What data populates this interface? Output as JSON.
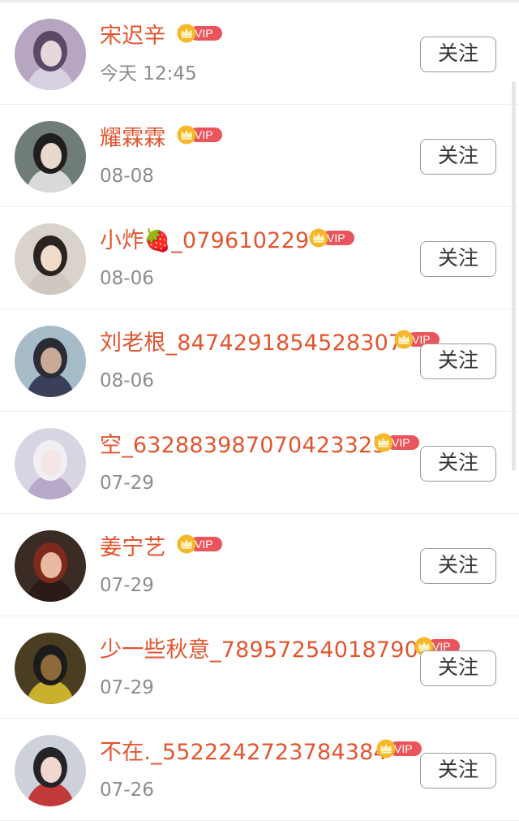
{
  "follow_label": "关注",
  "vip_label": "VIP",
  "colors": {
    "name": "#e2552f",
    "time": "#8c8c8c",
    "vip_badge": "#e9555a",
    "crown": "#f5b82a"
  },
  "rows": [
    {
      "name": "宋迟辛",
      "time": "今天 12:45"
    },
    {
      "name": "耀霖霖",
      "time": "08-08"
    },
    {
      "name": "小炸🍓_079610229",
      "time": "08-06"
    },
    {
      "name": "刘老根_8474291854528307",
      "time": "08-06"
    },
    {
      "name": "空_632883987070423325",
      "time": "07-29"
    },
    {
      "name": "姜宁艺",
      "time": "07-29"
    },
    {
      "name": "少一些秋意_78957254018790",
      "time": "07-29"
    },
    {
      "name": "不在._5522242723784384",
      "time": "07-26"
    }
  ]
}
